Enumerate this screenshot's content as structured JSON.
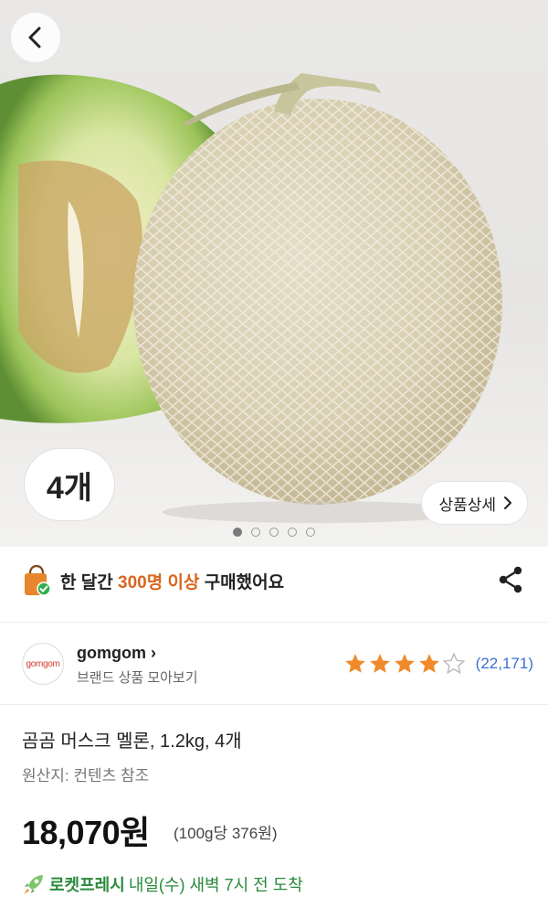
{
  "gallery": {
    "quantity_badge": "4개",
    "detail_button_label": "상품상세",
    "dot_count": 5,
    "active_dot": 0
  },
  "purchase_info": {
    "prefix": "한 달간 ",
    "highlight": "300명 이상",
    "suffix": " 구매했어요",
    "highlight_color": "#d9651e"
  },
  "brand": {
    "name": "gomgom",
    "logo_text": "gomgom",
    "subtitle": "브랜드 상품 모아보기",
    "rating": 4,
    "rating_max": 5,
    "review_count": "(22,171)"
  },
  "product": {
    "title": "곰곰 머스크 멜론, 1.2kg, 4개",
    "origin": "원산지: 컨텐츠 참조",
    "price": "18,070원",
    "unit_price": "(100g당 376원)"
  },
  "delivery": {
    "badge": "로켓프레시",
    "text": "내일(수) 새벽 7시 전  도착",
    "color": "#2a8a3c"
  },
  "icons": [
    "back-arrow-icon",
    "chevron-right-icon",
    "shopping-bag-icon",
    "share-icon",
    "star-icon",
    "rocket-icon"
  ]
}
